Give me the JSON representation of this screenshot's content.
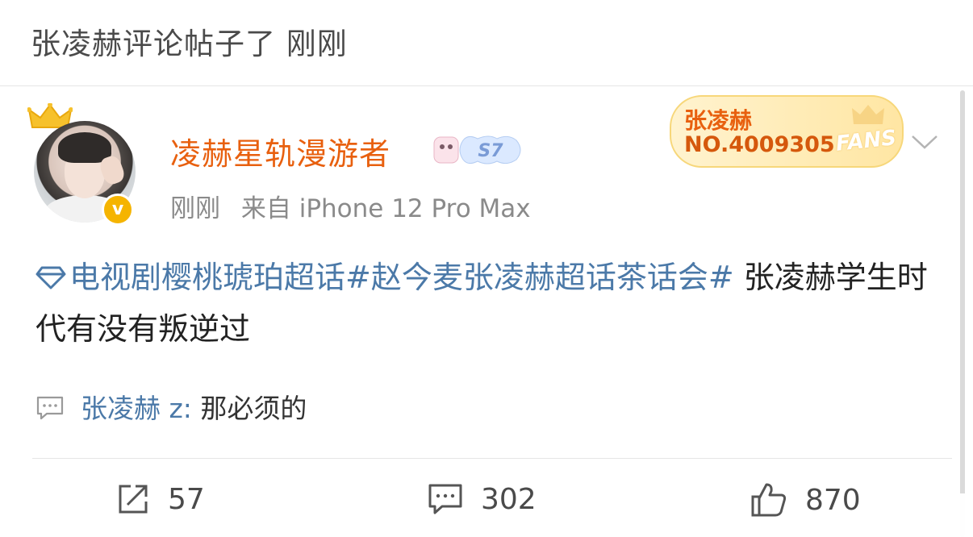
{
  "header": {
    "title": "张凌赫评论帖子了 刚刚"
  },
  "post": {
    "author": {
      "name": "凌赫星轨漫游者",
      "avatar_icon": "avatar-photo",
      "verified_icon": "verified-v-badge",
      "level_badge": "S7"
    },
    "time": "刚刚",
    "source": "来自 iPhone 12 Pro Max",
    "fans_badge": {
      "name": "张凌赫",
      "number": "NO.4009305",
      "label": "FANS"
    },
    "topics": "电视剧樱桃琥珀超话#赵今麦张凌赫超话茶话会#",
    "text": " 张凌赫学生时代有没有叛逆过",
    "comment": {
      "user": "张凌赫 z:",
      "text": " 那必须的"
    },
    "actions": {
      "reposts": "57",
      "comments": "302",
      "likes": "870"
    }
  },
  "colors": {
    "username": "#e8600f",
    "link": "#4b79a8",
    "verified": "#f5b400"
  }
}
